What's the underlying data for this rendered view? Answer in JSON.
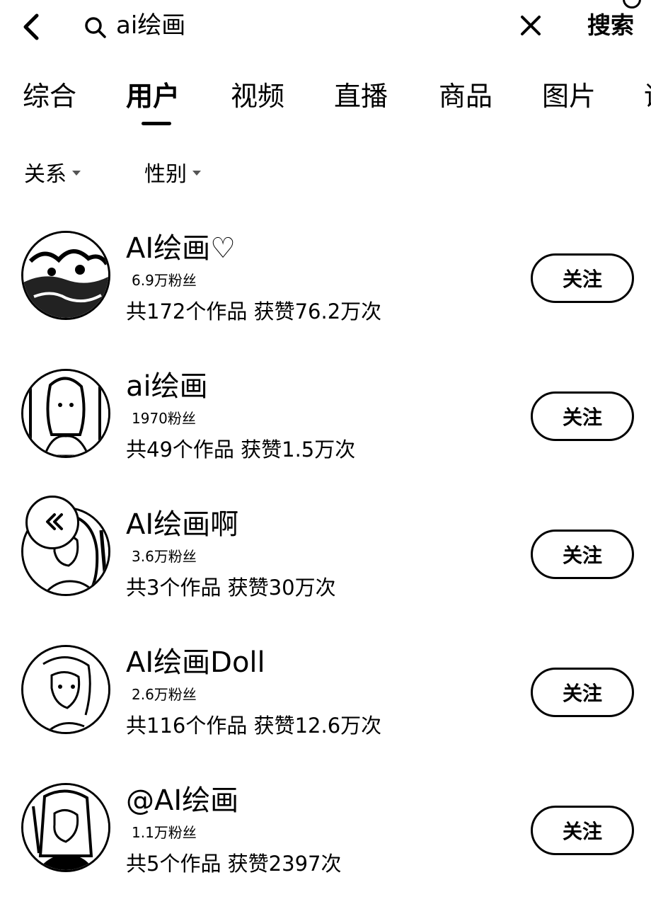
{
  "header": {
    "search_query": "ai绘画",
    "search_button": "搜索",
    "icons": [
      "chevron-left-icon",
      "search-icon",
      "close-icon"
    ]
  },
  "tabs": [
    {
      "label": "综合",
      "active": false
    },
    {
      "label": "用户",
      "active": true
    },
    {
      "label": "视频",
      "active": false
    },
    {
      "label": "直播",
      "active": false
    },
    {
      "label": "商品",
      "active": false
    },
    {
      "label": "图片",
      "active": false
    },
    {
      "label": "话",
      "active": false
    }
  ],
  "filters": [
    {
      "label": "关系"
    },
    {
      "label": "性别"
    }
  ],
  "results": [
    {
      "name": "AI绘画♡",
      "fans": "6.9万粉丝",
      "stats": "共172个作品 获赞76.2万次",
      "button": "关注"
    },
    {
      "name": "ai绘画",
      "fans": "1970粉丝",
      "stats": "共49个作品 获赞1.5万次",
      "button": "关注"
    },
    {
      "name": "AI绘画啊",
      "fans": "3.6万粉丝",
      "stats": "共3个作品 获赞30万次",
      "button": "关注"
    },
    {
      "name": "AI绘画Doll",
      "fans": "2.6万粉丝",
      "stats": "共116个作品 获赞12.6万次",
      "button": "关注"
    },
    {
      "name": "@AI绘画",
      "fans": "1.1万粉丝",
      "stats": "共5个作品 获赞2397次",
      "button": "关注"
    }
  ],
  "colors": {
    "background": "#ffffff",
    "text": "#000000",
    "accent": "#000000"
  }
}
